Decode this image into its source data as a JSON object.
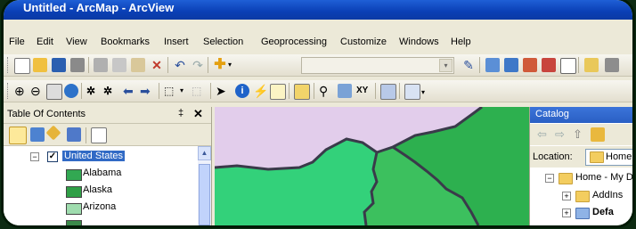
{
  "window": {
    "title": "Untitled - ArcMap - ArcView"
  },
  "menu": [
    "File",
    "Edit",
    "View",
    "Bookmarks",
    "Insert",
    "Selection",
    "Geoprocessing",
    "Customize",
    "Windows",
    "Help"
  ],
  "toc": {
    "title": "Table Of Contents",
    "pin": "‡",
    "close": "✕",
    "layer": {
      "label": "United States",
      "checked": true
    },
    "items": [
      {
        "label": "Alabama",
        "color": "#32a852"
      },
      {
        "label": "Alaska",
        "color": "#2f9f46"
      },
      {
        "label": "Arizona",
        "color": "#9fdcae"
      },
      {
        "label": "",
        "color": "#3a8b4a"
      }
    ]
  },
  "map": {
    "colors": {
      "lavender": "#e2cdeb",
      "green": "#33d17a",
      "dark_green": "#2db04f",
      "mid_green": "#3cc05e",
      "border": "#3a3a4a"
    }
  },
  "catalog": {
    "title": "Catalog",
    "location_label": "Location:",
    "location_value": "Home",
    "tree": [
      {
        "label": "Home - My D",
        "expander": "−"
      },
      {
        "label": "AddIns",
        "expander": "+"
      },
      {
        "label": "Defa",
        "expander": "+"
      }
    ]
  }
}
